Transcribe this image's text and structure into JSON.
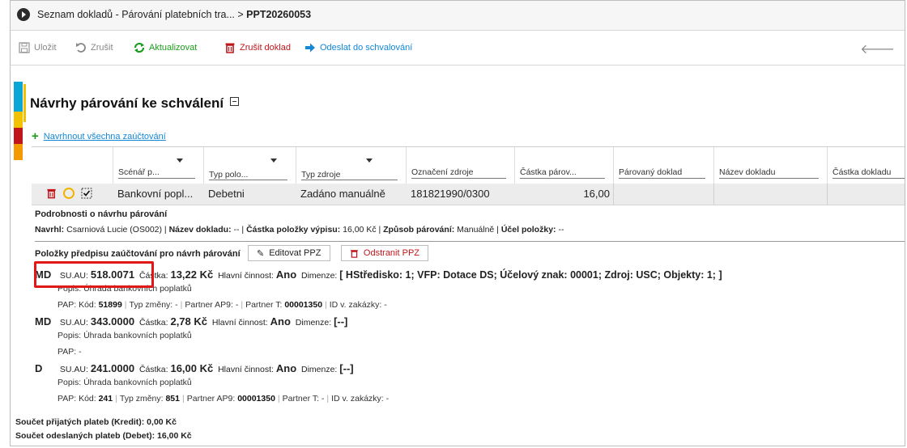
{
  "titlebar": {
    "breadcrumb": "Seznam dokladů - Párování platebních tra... > ",
    "doc_id": "PPT20260053"
  },
  "toolbar": {
    "save": "Uložit",
    "cancel": "Zrušit",
    "refresh": "Aktualizovat",
    "cancel_doc": "Zrušit doklad",
    "send": "Odeslat do schvalování"
  },
  "colors": {
    "accent_blue": "#0aa7d6",
    "accent_yellow": "#f2c200",
    "accent_red": "#c0161b",
    "accent_orange": "#f39a00",
    "green": "#1c9c1c",
    "link": "#1288d6",
    "highlight": "#e01818"
  },
  "section": {
    "title": "Návrhy párování ke schválení",
    "add_all": "Navrhnout všechna zaúčtování"
  },
  "grid": {
    "columns": [
      "Scénář p...",
      "Typ polo...",
      "Typ zdroje",
      "Označení zdroje",
      "Částka párov...",
      "Párovaný doklad",
      "Název dokladu",
      "Částka dokladu"
    ],
    "row": {
      "scenario": "Bankovní popl...",
      "item_type": "Debetni",
      "source_type": "Zadáno manuálně",
      "source_id": "181821990/0300",
      "amount": "16,00"
    }
  },
  "detail": {
    "title": "Podrobnosti o návrhu párování",
    "navrhl_label": "Navrhl:",
    "navrhl_value": " Csarniová Lucie (OS002) | ",
    "nazev_label": "Název dokladu:",
    "nazev_value": " -- | ",
    "castka_label": "Částka položky výpisu:",
    "castka_value": " 16,00 Kč | ",
    "zpusob_label": "Způsob párování:",
    "zpusob_value": " Manuálně | ",
    "ucel_label": "Účel položky:",
    "ucel_value": " --"
  },
  "ppz": {
    "title": "Položky předpisu zaúčtování pro návrh párování",
    "edit": "Editovat PPZ",
    "remove": "Odstranit PPZ"
  },
  "items": [
    {
      "type": "MD",
      "su_label": "SU.AU:",
      "su": "518.0071",
      "castka_label": "Částka:",
      "castka": "13,22 Kč",
      "hc_label": "Hlavní činnost:",
      "hc": "Ano",
      "dim_label": "Dimenze:",
      "dim": "[ HStředisko: 1; VFP: Dotace DS; Účelový znak: 00001; Zdroj: USC; Objekty: 1; ]",
      "popis": "Popis: Úhrada bankovních poplatků",
      "pap": "PAP: Kód:",
      "pap_kod": "51899",
      "typ_zmeny": "Typ změny: -",
      "partner_ap9": "Partner AP9: -",
      "partner_t_label": "Partner T:",
      "partner_t": "00001350",
      "id_zakazky": "ID v. zakázky: -"
    },
    {
      "type": "MD",
      "su_label": "SU.AU:",
      "su": "343.0000",
      "castka_label": "Částka:",
      "castka": "2,78 Kč",
      "hc_label": "Hlavní činnost:",
      "hc": "Ano",
      "dim_label": "Dimenze:",
      "dim": "[--]",
      "popis": "Popis: Úhrada bankovních poplatků",
      "pap": "PAP: -"
    },
    {
      "type": "D",
      "su_label": "SU.AU:",
      "su": "241.0000",
      "castka_label": "Částka:",
      "castka": "16,00 Kč",
      "hc_label": "Hlavní činnost:",
      "hc": "Ano",
      "dim_label": "Dimenze:",
      "dim": "[--]",
      "popis": "Popis: Úhrada bankovních poplatků",
      "pap": "PAP: Kód:",
      "pap_kod": "241",
      "typ_zmeny_label": "Typ změny:",
      "typ_zmeny_val": "851",
      "partner_ap9_label": "Partner AP9:",
      "partner_ap9_val": "00001350",
      "partner_t": "Partner T: -",
      "id_zakazky": "ID v. zakázky: -"
    }
  ],
  "summary": {
    "kredit": "Součet přijatých plateb (Kredit): 0,00 Kč",
    "debet": "Součet odeslaných plateb (Debet): 16,00 Kč"
  }
}
